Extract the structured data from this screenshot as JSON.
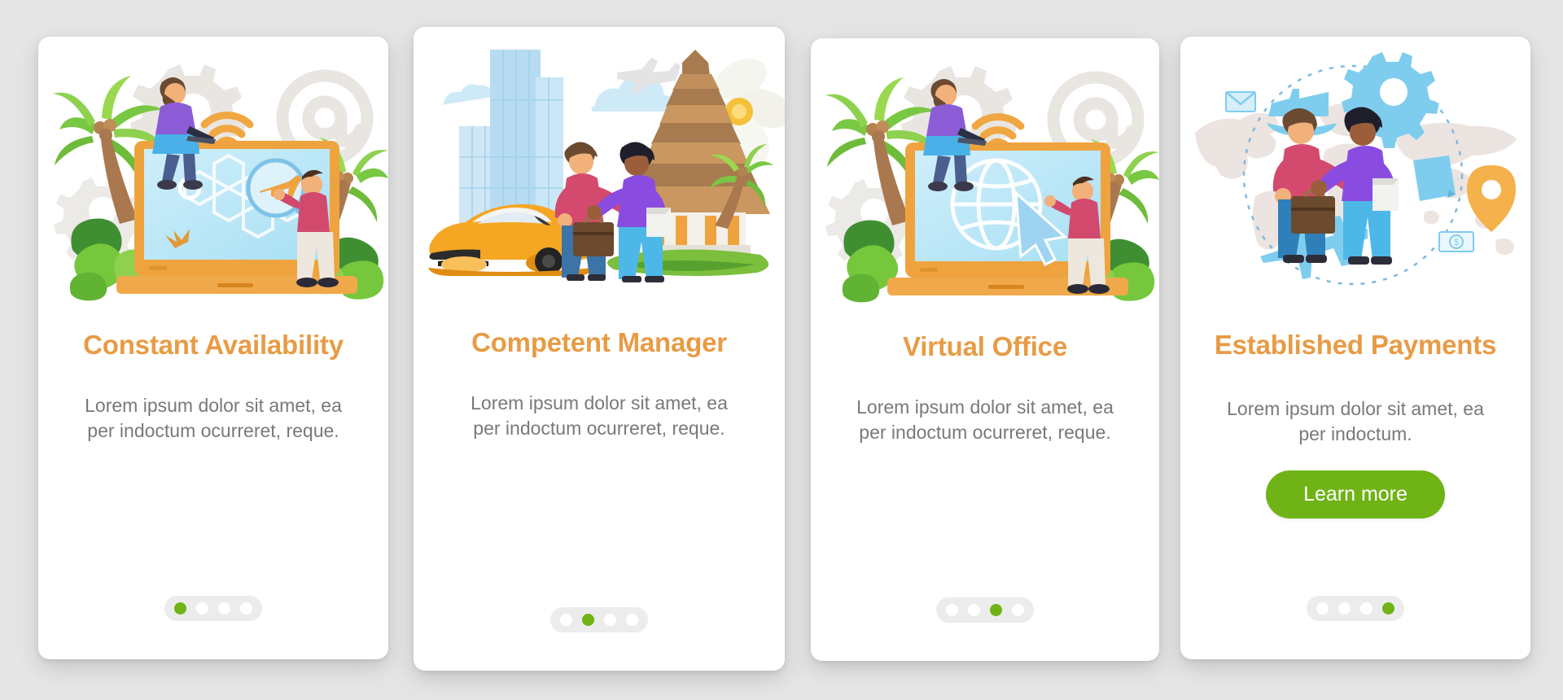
{
  "page": {
    "background_color": "#e6e6e6",
    "title_color": "#e89b45",
    "body_color": "#797979",
    "accent_green": "#6fb316",
    "card_background": "#ffffff",
    "pager_track_color": "#ececec",
    "pager_dot_color": "#ffffff"
  },
  "cards": [
    {
      "id": "card-1",
      "illustration_name": "laptop-palm-trees-flight-search-illustration",
      "illustration_elements": [
        "palm-tree",
        "gear-icon",
        "at-symbol-icon",
        "wifi-icon",
        "laptop",
        "person-with-laptop",
        "magnifier-icon",
        "airplane-icon",
        "hexagon-pattern",
        "monstera-leaf"
      ],
      "title": "Constant Availability",
      "body": "Lorem ipsum dolor sit amet, ea per indoctum ocurreret, reque.",
      "has_cta": false,
      "cta_label": "",
      "pager": {
        "total": 4,
        "active_index": 0
      }
    },
    {
      "id": "card-2",
      "illustration_name": "handshake-car-temple-illustration",
      "illustration_elements": [
        "glass-skyscraper",
        "cloud-icon",
        "airplane-icon",
        "orange-sports-car",
        "businessman-handshake",
        "briefcase",
        "balinese-temple",
        "plumeria-flower",
        "palm-tree"
      ],
      "title": "Competent Manager",
      "body": "Lorem ipsum dolor sit amet, ea per indoctum ocurreret, reque.",
      "has_cta": false,
      "cta_label": "",
      "pager": {
        "total": 4,
        "active_index": 1
      }
    },
    {
      "id": "card-3",
      "illustration_name": "laptop-globe-cursor-illustration",
      "illustration_elements": [
        "palm-tree",
        "gear-icon",
        "at-symbol-icon",
        "wifi-icon",
        "laptop",
        "person-with-laptop",
        "globe-icon",
        "cursor-arrow-icon",
        "monstera-leaf"
      ],
      "title": "Virtual Office",
      "body": "Lorem ipsum dolor sit amet, ea per indoctum ocurreret, reque.",
      "has_cta": false,
      "cta_label": "",
      "pager": {
        "total": 4,
        "active_index": 2
      }
    },
    {
      "id": "card-4",
      "illustration_name": "world-map-handshake-payments-illustration",
      "illustration_elements": [
        "world-map",
        "dashed-circle",
        "gear-icon",
        "envelope-icon",
        "cargo-ship-icon",
        "airplane-icon",
        "document-icon",
        "dollar-bill-icon",
        "location-pin-icon",
        "businessman-handshake",
        "briefcase"
      ],
      "title": "Established Payments",
      "body": "Lorem ipsum dolor sit amet, ea per indoctum.",
      "has_cta": true,
      "cta_label": "Learn more",
      "pager": {
        "total": 4,
        "active_index": 3
      }
    }
  ]
}
